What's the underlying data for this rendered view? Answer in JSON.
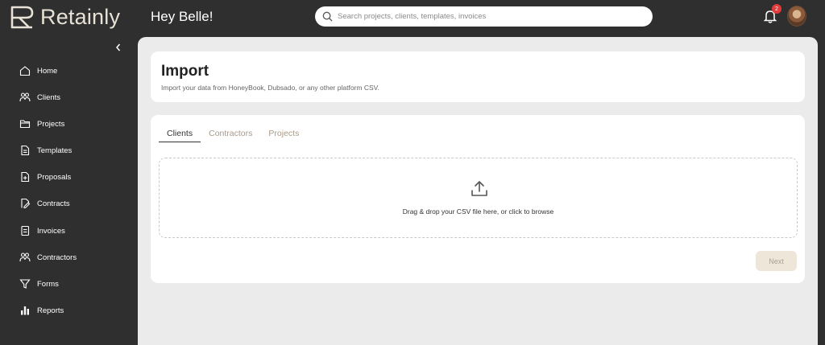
{
  "app": {
    "name": "Retainly"
  },
  "header": {
    "greeting": "Hey Belle!",
    "search_placeholder": "Search projects, clients, templates, invoices",
    "notification_count": "2"
  },
  "sidebar": {
    "items": [
      {
        "label": "Home",
        "icon": "home-icon"
      },
      {
        "label": "Clients",
        "icon": "users-icon"
      },
      {
        "label": "Projects",
        "icon": "folder-icon"
      },
      {
        "label": "Templates",
        "icon": "file-text-icon"
      },
      {
        "label": "Proposals",
        "icon": "file-plus-icon"
      },
      {
        "label": "Contracts",
        "icon": "file-signature-icon"
      },
      {
        "label": "Invoices",
        "icon": "receipt-icon"
      },
      {
        "label": "Contractors",
        "icon": "users-icon"
      },
      {
        "label": "Forms",
        "icon": "funnel-icon"
      },
      {
        "label": "Reports",
        "icon": "bar-chart-icon"
      }
    ]
  },
  "page": {
    "title": "Import",
    "subtitle": "Import your data from HoneyBook, Dubsado, or any other platform CSV.",
    "tabs": [
      {
        "label": "Clients",
        "active": true
      },
      {
        "label": "Contractors",
        "active": false
      },
      {
        "label": "Projects",
        "active": false
      }
    ],
    "dropzone_text": "Drag & drop your CSV file here, or click to browse",
    "next_label": "Next"
  },
  "colors": {
    "chrome": "#2f2f2f",
    "content_bg": "#ebebeb",
    "badge": "#e03a3a",
    "next_button_bg": "#efe6da"
  }
}
